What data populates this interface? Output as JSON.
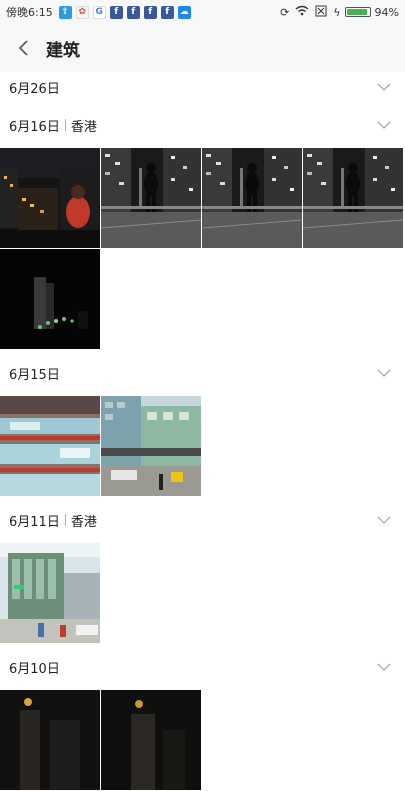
{
  "status": {
    "time": "傍晚6:15",
    "battery_percent_text": "94%",
    "battery_level": 0.94,
    "notification_icons": [
      "share-icon",
      "pinwheel-icon",
      "google-icon",
      "facebook-icon",
      "facebook-icon",
      "facebook-icon",
      "facebook-icon",
      "cloud-icon"
    ],
    "right_icons": [
      "sync-icon",
      "wifi-icon",
      "no-sim-icon",
      "charging-icon"
    ]
  },
  "header": {
    "title": "建筑"
  },
  "sections": [
    {
      "date": "6月26日",
      "location": "",
      "photos": []
    },
    {
      "date": "6月16日",
      "location": "香港",
      "photos": [
        "night-rooftop-person",
        "night-balcony-silhouette",
        "night-balcony-silhouette",
        "night-balcony-silhouette",
        "night-tower-lights"
      ]
    },
    {
      "date": "6月15日",
      "location": "",
      "photos": [
        "mall-facade",
        "street-buildings"
      ]
    },
    {
      "date": "6月11日",
      "location": "香港",
      "photos": [
        "glass-building-street"
      ]
    },
    {
      "date": "6月10日",
      "location": "",
      "photos": [
        "night-dark-1",
        "night-dark-2"
      ]
    }
  ],
  "colors": {
    "bar_bg": "#f7f7f7",
    "battery_fill": "#4caf50",
    "facebook": "#3b5998"
  }
}
